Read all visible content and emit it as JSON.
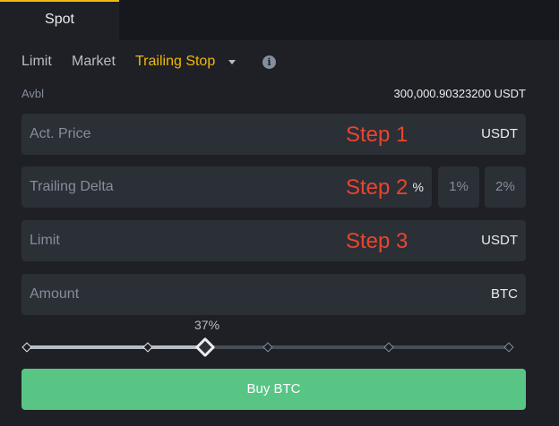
{
  "tabs": {
    "spot_label": "Spot"
  },
  "order_types": {
    "limit": "Limit",
    "market": "Market",
    "trailing_stop": "Trailing Stop",
    "dropdown_icon": "caret-down-icon",
    "info_icon": "info-icon"
  },
  "balance": {
    "label": "Avbl",
    "value": "300,000.90323200 USDT"
  },
  "fields": {
    "act_price": {
      "label": "Act. Price",
      "unit": "USDT",
      "step": "Step 1"
    },
    "trailing_delta": {
      "label": "Trailing Delta",
      "unit": "%",
      "step": "Step 2",
      "quick1": "1%",
      "quick2": "2%"
    },
    "limit": {
      "label": "Limit",
      "unit": "USDT",
      "step": "Step 3"
    },
    "amount": {
      "label": "Amount",
      "unit": "BTC"
    }
  },
  "slider": {
    "percent_label": "37%",
    "value_percent": 37,
    "marks_percent": [
      0,
      25,
      50,
      75,
      100
    ]
  },
  "buy_button": {
    "label": "Buy BTC"
  },
  "colors": {
    "accent": "#f0b90b",
    "buy": "#58c585",
    "step_annotation": "#e8462f"
  }
}
